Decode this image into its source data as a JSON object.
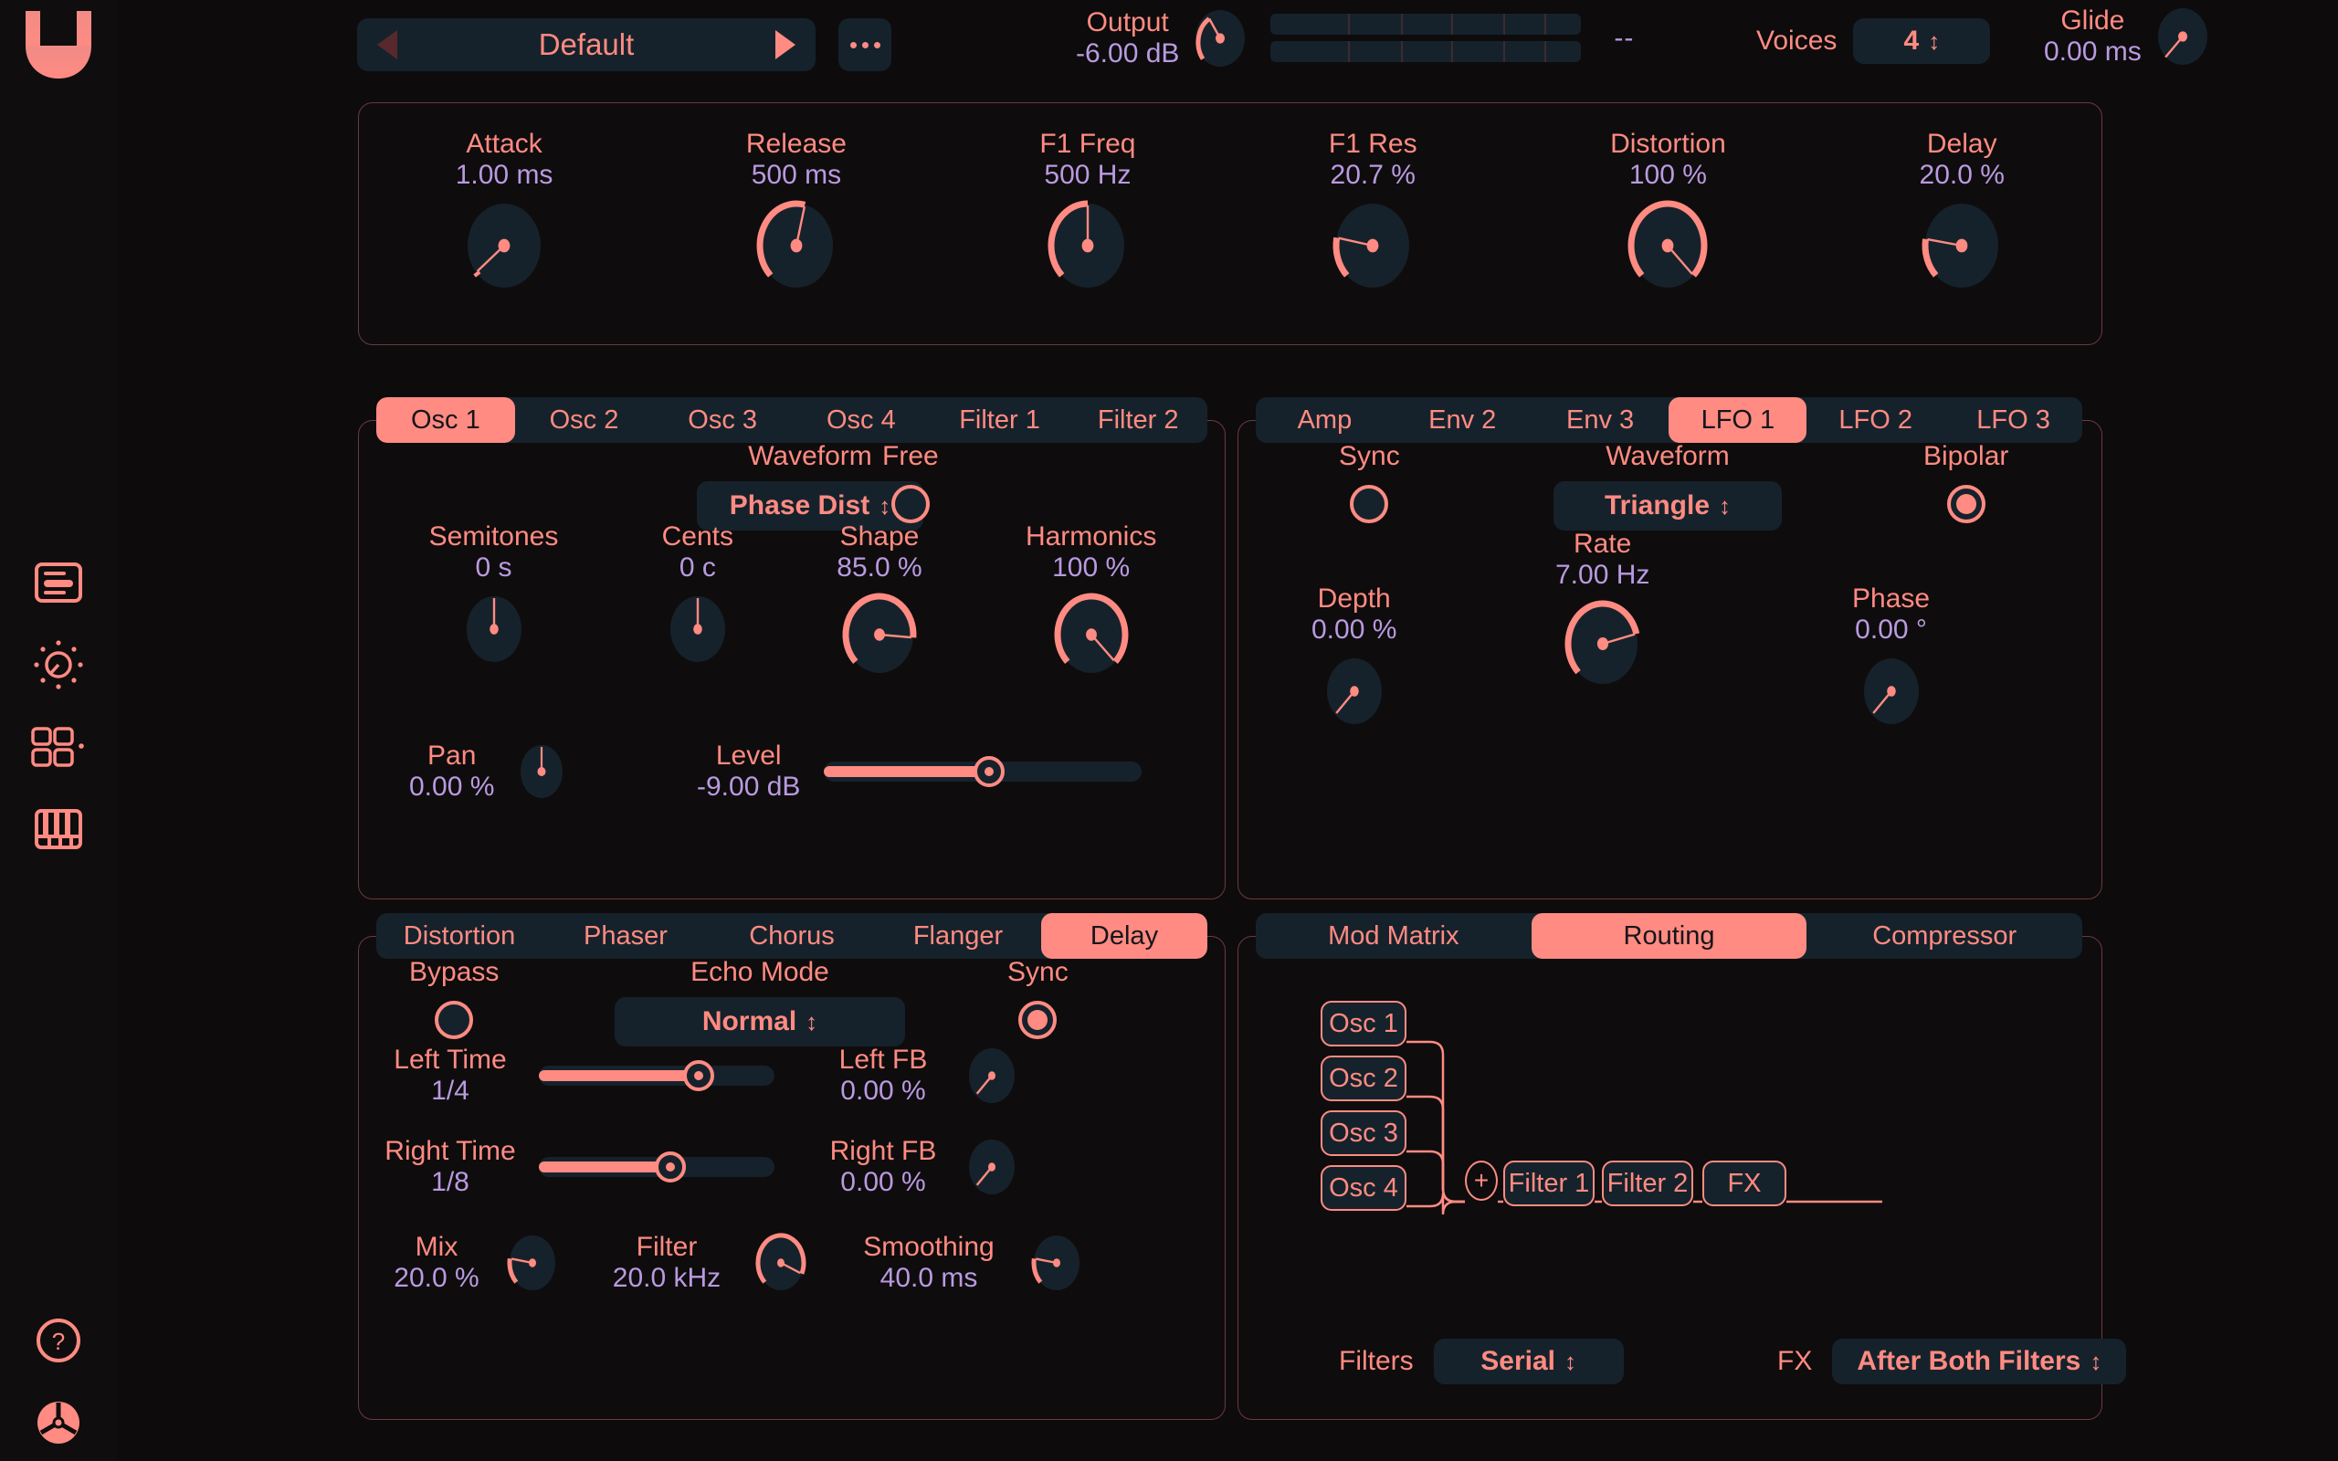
{
  "app": {
    "logo": "vital-wave-logo"
  },
  "sidebar": {
    "items": [
      {
        "name": "preset-browser",
        "icon": "preset-list-icon"
      },
      {
        "name": "sound-design",
        "icon": "knob-icon"
      },
      {
        "name": "matrix",
        "icon": "grid-icon"
      },
      {
        "name": "keyboard",
        "icon": "keyboard-icon"
      }
    ],
    "bottom": [
      {
        "name": "help",
        "icon": "question-circle-icon"
      },
      {
        "name": "settings",
        "icon": "gear-icon"
      }
    ]
  },
  "topbar": {
    "preset": {
      "name": "Default",
      "prev": "prev-preset",
      "next": "next-preset",
      "more": "more-options"
    },
    "output": {
      "label": "Output",
      "value": "-6.00 dB"
    },
    "meter": {
      "readout": "--"
    },
    "voices": {
      "label": "Voices",
      "value": "4"
    },
    "glide": {
      "label": "Glide",
      "value": "0.00 ms"
    }
  },
  "macros": [
    {
      "label": "Attack",
      "value": "1.00 ms",
      "pct": 0.02
    },
    {
      "label": "Release",
      "value": "500 ms",
      "pct": 0.55
    },
    {
      "label": "F1 Freq",
      "value": "500 Hz",
      "pct": 0.5
    },
    {
      "label": "F1 Res",
      "value": "20.7 %",
      "pct": 0.207
    },
    {
      "label": "Distortion",
      "value": "100 %",
      "pct": 1.0
    },
    {
      "label": "Delay",
      "value": "20.0 %",
      "pct": 0.2
    }
  ],
  "osc_panel": {
    "tabs": [
      "Osc 1",
      "Osc 2",
      "Osc 3",
      "Osc 4",
      "Filter 1",
      "Filter 2"
    ],
    "active_tab": "Osc 1",
    "waveform": {
      "label": "Waveform",
      "value": "Phase Dist"
    },
    "free": {
      "label": "Free",
      "on": false
    },
    "knobs": [
      {
        "label": "Semitones",
        "value": "0 s",
        "pct": 0.5,
        "arc": false
      },
      {
        "label": "Cents",
        "value": "0 c",
        "pct": 0.5,
        "arc": false
      },
      {
        "label": "Shape",
        "value": "85.0 %",
        "pct": 0.85,
        "arc": true
      },
      {
        "label": "Harmonics",
        "value": "100 %",
        "pct": 1.0,
        "arc": true
      }
    ],
    "pan": {
      "label": "Pan",
      "value": "0.00 %",
      "pct": 0.5
    },
    "level": {
      "label": "Level",
      "value": "-9.00 dB",
      "pct": 0.52
    }
  },
  "mod_panel": {
    "tabs": [
      "Amp",
      "Env 2",
      "Env 3",
      "LFO 1",
      "LFO 2",
      "LFO 3"
    ],
    "active_tab": "LFO 1",
    "sync": {
      "label": "Sync",
      "on": false
    },
    "waveform": {
      "label": "Waveform",
      "value": "Triangle"
    },
    "bipolar": {
      "label": "Bipolar",
      "on": true
    },
    "rate": {
      "label": "Rate",
      "value": "7.00 Hz",
      "pct": 0.78
    },
    "depth": {
      "label": "Depth",
      "value": "0.00 %",
      "pct": 0.0
    },
    "phase": {
      "label": "Phase",
      "value": "0.00 °",
      "pct": 0.0
    }
  },
  "fx_panel": {
    "tabs": [
      "Distortion",
      "Phaser",
      "Chorus",
      "Flanger",
      "Delay"
    ],
    "active_tab": "Delay",
    "bypass": {
      "label": "Bypass",
      "on": false
    },
    "echo_mode": {
      "label": "Echo Mode",
      "value": "Normal"
    },
    "sync": {
      "label": "Sync",
      "on": true
    },
    "left_time": {
      "label": "Left Time",
      "value": "1/4",
      "pct": 0.68
    },
    "right_time": {
      "label": "Right Time",
      "value": "1/8",
      "pct": 0.56
    },
    "left_fb": {
      "label": "Left FB",
      "value": "0.00 %",
      "pct": 0.0
    },
    "right_fb": {
      "label": "Right FB",
      "value": "0.00 %",
      "pct": 0.0
    },
    "mix": {
      "label": "Mix",
      "value": "20.0 %",
      "pct": 0.2
    },
    "filter": {
      "label": "Filter",
      "value": "20.0 kHz",
      "pct": 0.92
    },
    "smoothing": {
      "label": "Smoothing",
      "value": "40.0 ms",
      "pct": 0.2
    }
  },
  "routing_panel": {
    "tabs": [
      "Mod Matrix",
      "Routing",
      "Compressor"
    ],
    "active_tab": "Routing",
    "sources": [
      "Osc 1",
      "Osc 2",
      "Osc 3",
      "Osc 4"
    ],
    "sum": "+",
    "chain": [
      "Filter 1",
      "Filter 2",
      "FX"
    ],
    "filters_mode": {
      "label": "Filters",
      "value": "Serial"
    },
    "fx_mode": {
      "label": "FX",
      "value": "After Both Filters"
    }
  },
  "colors": {
    "accent": "#ff8b82",
    "value_text": "#b99ae0",
    "panel_border": "#6b3a3c",
    "control_bg": "#16222b",
    "background": "#0d0b0c"
  }
}
